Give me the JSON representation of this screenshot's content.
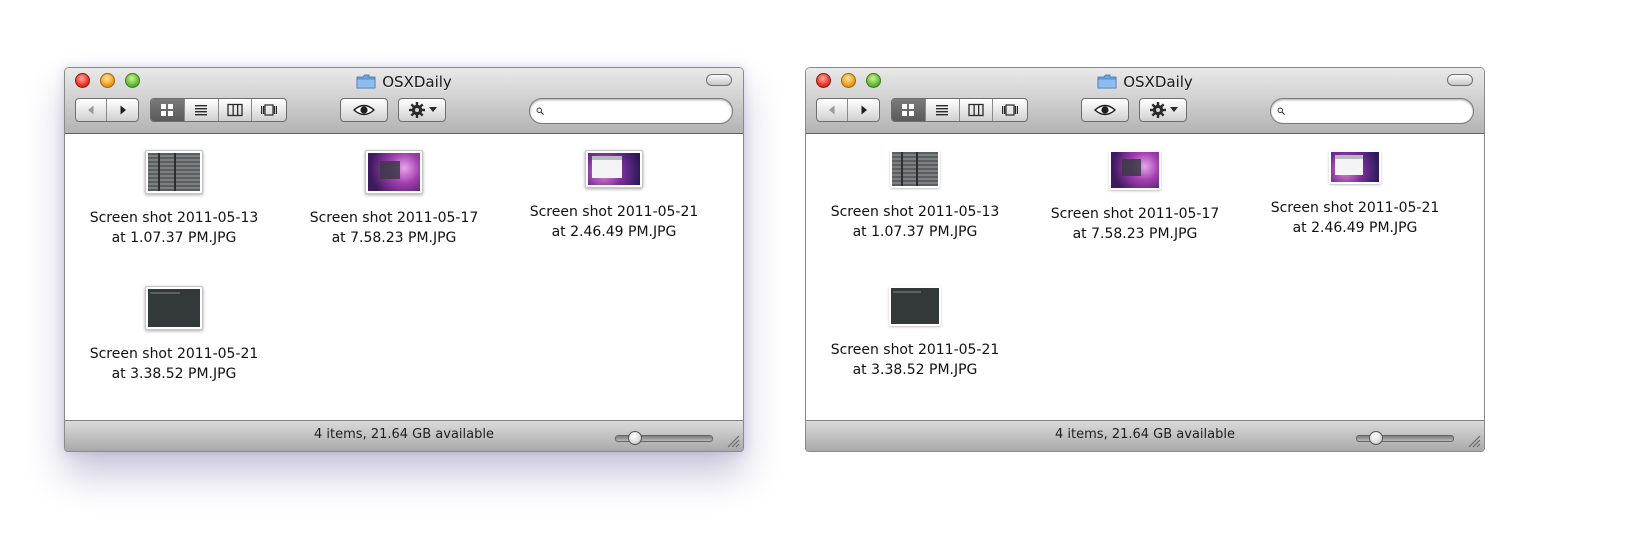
{
  "windows": [
    {
      "title": "OSXDaily",
      "shadow": true,
      "files": [
        {
          "line1": "Screen shot 2011-05-13",
          "line2": "at 1.07.37 PM.JPG",
          "thumb": "gray-screenshot-thumbnail"
        },
        {
          "line1": "Screen shot 2011-05-17",
          "line2": "at 7.58.23 PM.JPG",
          "thumb": "purple-desktop-thumbnail"
        },
        {
          "line1": "Screen shot 2011-05-21",
          "line2": "at 2.46.49 PM.JPG",
          "thumb": "finder-window-thumbnail"
        },
        {
          "line1": "Screen shot 2011-05-21",
          "line2": "at 3.38.52 PM.JPG",
          "thumb": "dark-terminal-thumbnail"
        }
      ],
      "status": "4 items, 21.64 GB available",
      "icon_size_fraction": 0.18
    },
    {
      "title": "OSXDaily",
      "shadow": false,
      "files": [
        {
          "line1": "Screen shot 2011-05-13",
          "line2": "at 1.07.37 PM.JPG",
          "thumb": "gray-screenshot-thumbnail"
        },
        {
          "line1": "Screen shot 2011-05-17",
          "line2": "at 7.58.23 PM.JPG",
          "thumb": "purple-desktop-thumbnail"
        },
        {
          "line1": "Screen shot 2011-05-21",
          "line2": "at 2.46.49 PM.JPG",
          "thumb": "finder-window-thumbnail"
        },
        {
          "line1": "Screen shot 2011-05-21",
          "line2": "at 3.38.52 PM.JPG",
          "thumb": "dark-terminal-thumbnail"
        }
      ],
      "status": "4 items, 21.64 GB available",
      "icon_size_fraction": 0.18
    }
  ],
  "toolbar": {
    "search_placeholder": "",
    "search_value": "",
    "active_view": "icon-view"
  },
  "colors": {
    "window_shadow": "#5046b4",
    "selected_view_button": "#5a5a5a",
    "folder_blue": "#6aa6e6"
  }
}
